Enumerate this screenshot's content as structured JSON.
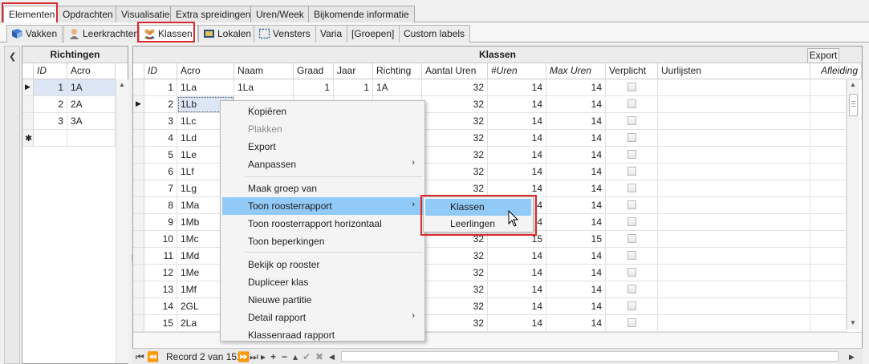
{
  "tabs_main": [
    {
      "label": "Elementen"
    },
    {
      "label": "Opdrachten"
    },
    {
      "label": "Visualisatie"
    },
    {
      "label": "Extra spreidingen"
    },
    {
      "label": "Uren/Week"
    },
    {
      "label": "Bijkomende informatie"
    }
  ],
  "tabs_sub": [
    {
      "label": "Vakken",
      "icon": "book-icon"
    },
    {
      "label": "Leerkrachten",
      "icon": "teacher-icon"
    },
    {
      "label": "Klassen",
      "icon": "group-icon"
    },
    {
      "label": "Lokalen",
      "icon": "room-icon"
    },
    {
      "label": "Vensters",
      "icon": "window-icon"
    },
    {
      "label": "Varia"
    },
    {
      "label": "[Groepen]"
    },
    {
      "label": "Custom labels"
    }
  ],
  "richtingen": {
    "caption": "Richtingen",
    "columns": [
      "ID",
      "Acro"
    ],
    "rows": [
      {
        "id": "1",
        "acro": "1A"
      },
      {
        "id": "2",
        "acro": "2A"
      },
      {
        "id": "3",
        "acro": "3A"
      }
    ],
    "new_row_marker": "✱"
  },
  "klassen": {
    "caption": "Klassen",
    "export_label": "Export",
    "columns": [
      "ID",
      "Acro",
      "Naam",
      "Graad",
      "Jaar",
      "Richting",
      "Aantal Uren",
      "#Uren",
      "Max Uren",
      "Verplicht",
      "Uurlijsten",
      "Afleiding"
    ],
    "rows": [
      {
        "id": "1",
        "acro": "1La",
        "naam": "1La",
        "graad": "1",
        "jaar": "1",
        "richting": "1A",
        "aantal": "32",
        "uren": "14",
        "max": "14"
      },
      {
        "id": "2",
        "acro": "1Lb",
        "naam": "",
        "graad": "",
        "jaar": "",
        "richting": "",
        "aantal": "32",
        "uren": "14",
        "max": "14"
      },
      {
        "id": "3",
        "acro": "1Lc",
        "aantal": "32",
        "uren": "14",
        "max": "14"
      },
      {
        "id": "4",
        "acro": "1Ld",
        "aantal": "32",
        "uren": "14",
        "max": "14"
      },
      {
        "id": "5",
        "acro": "1Le",
        "aantal": "32",
        "uren": "14",
        "max": "14"
      },
      {
        "id": "6",
        "acro": "1Lf",
        "aantal": "32",
        "uren": "14",
        "max": "14"
      },
      {
        "id": "7",
        "acro": "1Lg",
        "aantal": "32",
        "uren": "14",
        "max": "14"
      },
      {
        "id": "8",
        "acro": "1Ma",
        "aantal": "",
        "uren": "4",
        "max": "14"
      },
      {
        "id": "9",
        "acro": "1Mb",
        "aantal": "",
        "uren": "4",
        "max": "14"
      },
      {
        "id": "10",
        "acro": "1Mc",
        "aantal": "32",
        "uren": "15",
        "max": "15"
      },
      {
        "id": "11",
        "acro": "1Md",
        "aantal": "32",
        "uren": "14",
        "max": "14"
      },
      {
        "id": "12",
        "acro": "1Me",
        "aantal": "32",
        "uren": "14",
        "max": "14"
      },
      {
        "id": "13",
        "acro": "1Mf",
        "aantal": "32",
        "uren": "14",
        "max": "14"
      },
      {
        "id": "14",
        "acro": "2GL",
        "aantal": "32",
        "uren": "14",
        "max": "14"
      },
      {
        "id": "15",
        "acro": "2La",
        "aantal": "32",
        "uren": "14",
        "max": "14"
      }
    ]
  },
  "navigator": {
    "record_text": "Record 2 van 151"
  },
  "context_menu": {
    "items": [
      {
        "label": "Kopiëren"
      },
      {
        "label": "Plakken",
        "disabled": true
      },
      {
        "label": "Export"
      },
      {
        "label": "Aanpassen",
        "submenu": true
      },
      {
        "label": "Maak groep van"
      },
      {
        "label": "Toon roosterrapport",
        "submenu": true,
        "highlighted": true
      },
      {
        "label": "Toon roosterrapport horizontaal"
      },
      {
        "label": "Toon beperkingen"
      },
      {
        "label": "Bekijk op rooster"
      },
      {
        "label": "Dupliceer klas"
      },
      {
        "label": "Nieuwe partitie"
      },
      {
        "label": "Detail rapport",
        "submenu": true
      },
      {
        "label": "Klassenraad rapport"
      }
    ],
    "submenu_items": [
      {
        "label": "Klassen",
        "highlighted": true
      },
      {
        "label": "Leerlingen"
      }
    ]
  },
  "colors": {
    "highlight": "#91c9f7",
    "annotation_red": "#d9292e"
  }
}
